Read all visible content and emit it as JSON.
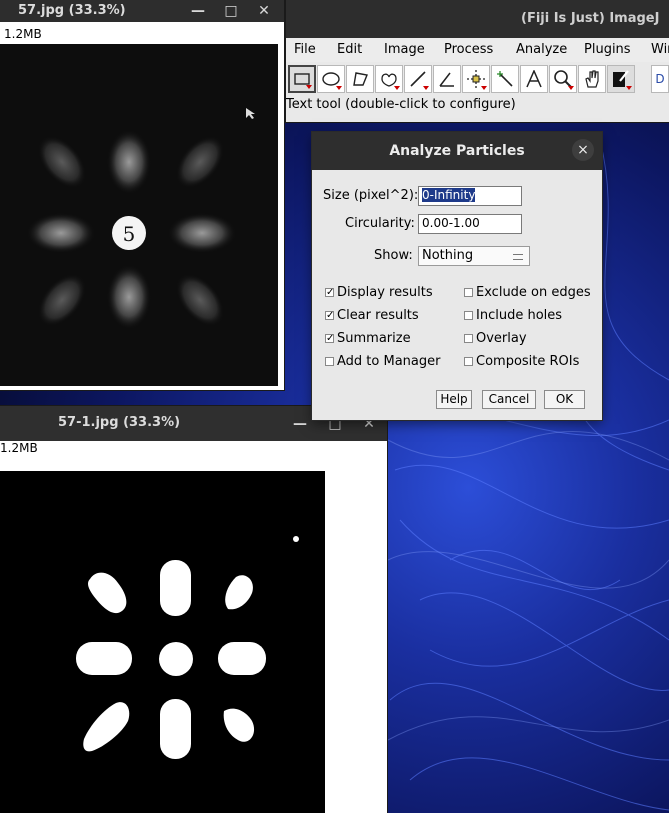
{
  "window1": {
    "title": "57.jpg (33.3%)",
    "info": "1.2MB",
    "center_label": "5"
  },
  "imagej": {
    "title": "(Fiji Is Just) ImageJ",
    "menus": [
      "File",
      "Edit",
      "Image",
      "Process",
      "Analyze",
      "Plugins",
      "Win"
    ],
    "tools": [
      "rectangle-tool-icon",
      "oval-tool-icon",
      "polygon-tool-icon",
      "freehand-tool-icon",
      "line-tool-icon",
      "angle-tool-icon",
      "point-tool-icon",
      "wand-tool-icon",
      "text-tool-icon",
      "zoom-tool-icon",
      "hand-tool-icon",
      "color-picker-icon"
    ],
    "extra_tool_label": "D",
    "status": "Text tool (double-click to configure)"
  },
  "dialog": {
    "title": "Analyze Particles",
    "close": "×",
    "size_label": "Size (pixel^2):",
    "size_value": "0-Infinity",
    "circularity_label": "Circularity:",
    "circularity_value": "0.00-1.00",
    "show_label": "Show:",
    "show_value": "Nothing",
    "checkboxes_left": [
      {
        "label": "Display results",
        "checked": true
      },
      {
        "label": "Clear results",
        "checked": true
      },
      {
        "label": "Summarize",
        "checked": true
      },
      {
        "label": "Add to Manager",
        "checked": false
      }
    ],
    "checkboxes_right": [
      {
        "label": "Exclude on edges",
        "checked": false
      },
      {
        "label": "Include holes",
        "checked": false
      },
      {
        "label": "Overlay",
        "checked": false
      },
      {
        "label": "Composite ROIs",
        "checked": false
      }
    ],
    "help_label": "Help",
    "cancel_label": "Cancel",
    "ok_label": "OK"
  },
  "window2": {
    "title": "57-1.jpg (33.3%)",
    "info": "1.2MB"
  },
  "titlebar_buttons": {
    "minimize": "—",
    "maximize": "□",
    "close": "✕"
  }
}
